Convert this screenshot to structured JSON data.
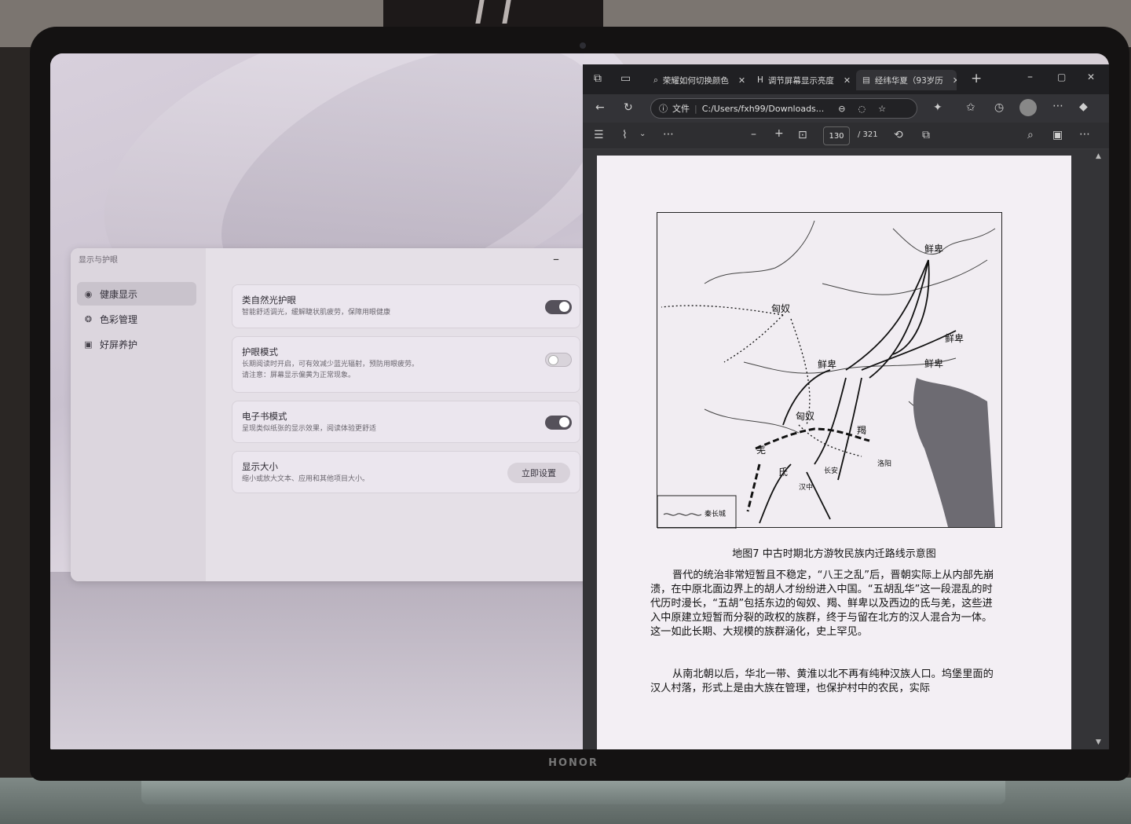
{
  "settings": {
    "window_title": "显示与护眼",
    "nav": [
      {
        "label": "健康显示",
        "icon": "eye-icon"
      },
      {
        "label": "色彩管理",
        "icon": "palette-icon"
      },
      {
        "label": "好屏养护",
        "icon": "screen-care-icon"
      }
    ],
    "cards": [
      {
        "title": "类自然光护眼",
        "desc": "智能舒适调光，缓解睫状肌疲劳，保障用眼健康",
        "toggle": "on"
      },
      {
        "title": "护眼模式",
        "desc": "长期阅读时开启，可有效减少蓝光辐射，预防用眼疲劳。",
        "desc2": "请注意：屏幕显示偏黄为正常现象。",
        "toggle": "off"
      },
      {
        "title": "电子书模式",
        "desc": "呈现类似纸张的显示效果，阅读体验更舒适",
        "toggle": "on"
      },
      {
        "title": "显示大小",
        "desc": "缩小或放大文本、应用和其他项目大小。",
        "button": "立即设置"
      }
    ]
  },
  "browser": {
    "tabs": [
      {
        "title": "荣耀如何切换颜色"
      },
      {
        "title": "调节屏幕显示亮度"
      },
      {
        "title": "经纬华夏（93岁历"
      }
    ],
    "address": {
      "scheme_label": "文件",
      "url": "C:/Users/fxh99/Downloads..."
    },
    "pdf": {
      "page": "130",
      "total": "/ 321"
    }
  },
  "document": {
    "map_labels": {
      "xianbei1": "鲜卑",
      "xiongnu1": "匈奴",
      "xianbei2": "鲜卑",
      "xianbei3": "鲜卑",
      "xianbei4": "鲜卑",
      "xiongnu2": "匈奴",
      "jie": "羯",
      "qiang": "羌",
      "di": "氐",
      "changan": "长安",
      "luoyang": "洛阳",
      "hanzhong": "汉中",
      "legend": "秦长城"
    },
    "caption": "地图7 中古时期北方游牧民族内迁路线示意图",
    "para1": "晋代的统治非常短暂且不稳定，“八王之乱”后，晋朝实际上从内部先崩溃，在中原北面边界上的胡人才纷纷进入中国。“五胡乱华”这一段混乱的时代历时漫长，“五胡”包括东边的匈奴、羯、鲜卑以及西边的氐与羌，这些进入中原建立短暂而分裂的政权的族群，终于与留在北方的汉人混合为一体。这一如此长期、大规模的族群涵化，史上罕见。",
    "para2": "从南北朝以后，华北一带、黄淮以北不再有纯种汉族人口。坞堡里面的汉人村落，形式上是由大族在管理，也保护村中的农民，实际"
  },
  "device": {
    "brand": "HONOR"
  }
}
